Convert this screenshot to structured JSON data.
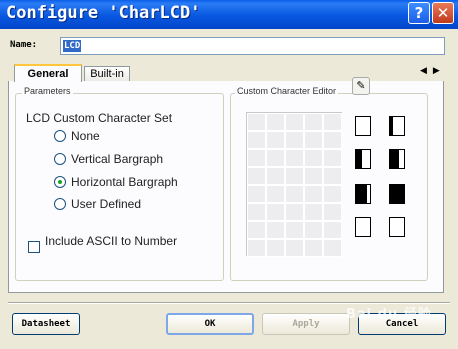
{
  "window": {
    "title": "Configure 'CharLCD'",
    "help_button": "?",
    "close_button": "✕"
  },
  "name_field": {
    "label": "Name:",
    "value": "LCD"
  },
  "tabs": [
    {
      "label": "General",
      "active": true
    },
    {
      "label": "Built-in",
      "active": false
    }
  ],
  "tab_nav": {
    "prev": "◀",
    "next": "▶"
  },
  "parameters": {
    "group_label": "Parameters",
    "set_label": "LCD Custom Character Set",
    "options": [
      {
        "label": "None",
        "selected": false
      },
      {
        "label": "Vertical Bargraph",
        "selected": false
      },
      {
        "label": "Horizontal Bargraph",
        "selected": true
      },
      {
        "label": "User Defined",
        "selected": false
      }
    ],
    "include_ascii": {
      "label": "Include ASCII to Number",
      "checked": false
    }
  },
  "editor": {
    "group_label": "Custom Character Editor",
    "icon": "edit-icon"
  },
  "buttons": {
    "datasheet": "Datasheet",
    "ok": "OK",
    "apply": "Apply",
    "cancel": "Cancel"
  },
  "watermark": "Bai du 经验"
}
